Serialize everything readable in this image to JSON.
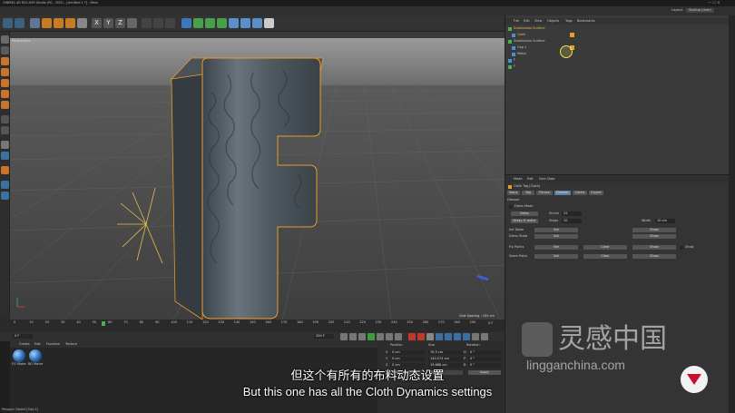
{
  "window": {
    "title": "CINEMA 4D R20.059 Studio (RC - R20) - [Untitled 1 *] - Main"
  },
  "menu": [
    "File",
    "Edit",
    "Create",
    "Select",
    "Tools",
    "Mesh",
    "Volume",
    "Snap",
    "Animate",
    "Simulate",
    "Render",
    "Sculpt",
    "Motion Tracker",
    "MoGraph",
    "Character",
    "Pipeline",
    "Plugins",
    "X-Particles",
    "Octane",
    "Redshift",
    "Script",
    "Window",
    "Help"
  ],
  "layout": {
    "label": "Layout:",
    "value": "Startup (User)"
  },
  "viewport": {
    "menu": [
      "View",
      "Cameras",
      "Display",
      "Options",
      "Filter",
      "Panel",
      "ProRender"
    ],
    "label": "Perspective",
    "grid_spacing": "Grid Spacing : 100 cm"
  },
  "timeline": {
    "ticks": [
      "0",
      "10",
      "20",
      "30",
      "40",
      "50",
      "60",
      "70",
      "80",
      "90",
      "100",
      "110",
      "120",
      "130",
      "140",
      "150",
      "160",
      "170",
      "180",
      "190",
      "200",
      "210",
      "220",
      "230",
      "240",
      "250",
      "260",
      "270",
      "280",
      "290"
    ],
    "end_label": "0 F",
    "start_field": "0 F",
    "end_field": "300 F"
  },
  "materials": {
    "menu": [
      "Create",
      "Edit",
      "Function",
      "Texture"
    ],
    "items": [
      {
        "label": "FG Mater"
      },
      {
        "label": "BG Mater"
      }
    ]
  },
  "coords": {
    "headers": [
      "Position",
      "Size",
      "Rotation"
    ],
    "rows": [
      {
        "axis": "X",
        "pos": "0 cm",
        "size": "76.5 cm",
        "rot_axis": "H",
        "rot": "0 °"
      },
      {
        "axis": "Y",
        "pos": "0 cm",
        "size": "140.574 cm",
        "rot_axis": "P",
        "rot": "0 °"
      },
      {
        "axis": "Z",
        "pos": "0 cm",
        "size": "19.668 cm",
        "rot_axis": "B",
        "rot": "0 °"
      }
    ],
    "mode": "Object (Rel)",
    "size_mode": "Size",
    "apply": "Apply"
  },
  "status": "Polygon Object [Cap 1]",
  "objects": {
    "menu": [
      "File",
      "Edit",
      "View",
      "Objects",
      "Tags",
      "Bookmarks"
    ],
    "items": [
      {
        "name": "Subdivision Surface"
      },
      {
        "name": "Cloth"
      },
      {
        "name": "Subdivision Surface"
      },
      {
        "name": "Cap 1"
      },
      {
        "name": "Metal"
      },
      {
        "name": "F"
      },
      {
        "name": "F"
      }
    ]
  },
  "attributes": {
    "menu": [
      "Mode",
      "Edit",
      "User Data"
    ],
    "title": "Cloth Tag [Cloth]",
    "tabs": [
      "Basic",
      "Tag",
      "Forces",
      "Dresser",
      "Cache",
      "Expert"
    ],
    "active_tab": "Dresser",
    "section": "Dresser",
    "dress_mode": "Dress Mode",
    "dress_btn": "Dress",
    "shrink_label": "Shrink",
    "shrink_value": "25",
    "dress_o_matic": "Dress-O-matic",
    "steps_label": "Steps",
    "steps_value": "20",
    "width_label": "Width",
    "width_value": "10 cm",
    "rows": [
      {
        "label": "Init State",
        "set": "Set",
        "mid": "",
        "show": "Show"
      },
      {
        "label": "Dress State",
        "set": "Set",
        "mid": "",
        "show": "Show"
      },
      {
        "label": "Fix Points",
        "set": "Set",
        "mid": "Clear",
        "show": "Show"
      },
      {
        "label": "Seam Polys",
        "set": "Set",
        "mid": "Clear",
        "show": "Show"
      }
    ],
    "show_check": "Show"
  },
  "subtitles": {
    "cn": "但这个有所有的布料动态设置",
    "en": "But this one has all the Cloth Dynamics settings"
  },
  "watermark": {
    "cn": "灵感中国",
    "url": "lingganchina.com"
  },
  "colors": {
    "accent": "#e79a2a",
    "selection": "#f0e25a",
    "mesh": "#4f5860",
    "bg": "#2b2b2b",
    "brand": "#c8102e"
  }
}
